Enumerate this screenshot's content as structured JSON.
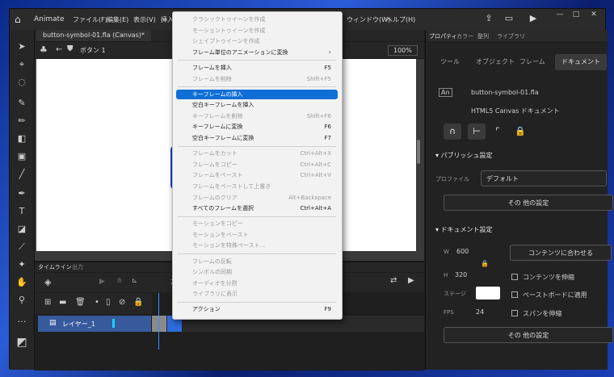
{
  "app": {
    "name": "Animate"
  },
  "menubar": [
    "ファイル(F)",
    "編集(E)",
    "表示(V)",
    "挿入",
    "ウィンドウ(W)",
    "ヘルプ(H)"
  ],
  "document": {
    "tab": "button-symbol-01.fla (Canvas)*",
    "symbol": "ボタン 1",
    "zoom": "100%"
  },
  "timeline": {
    "tabs": [
      "タイムライン",
      "出力"
    ],
    "frame_number": "24",
    "layer_name": "レイヤー_1"
  },
  "panel": {
    "tabs": [
      "プロパティ",
      "カラー",
      "整列",
      "ライブラリ"
    ],
    "subtabs": [
      "ツール",
      "オブジェクト",
      "フレーム",
      "ドキュメント"
    ],
    "active_subtab": "ドキュメント",
    "doc_name": "button-symbol-01.fla",
    "doc_type": "HTML5 Canvas ドキュメント",
    "publish_header": "パブリッシュ設定",
    "profile_label": "プロファイル",
    "profile_value": "デフォルト",
    "other_settings": "その 他の設定",
    "doc_settings_header": "ドキュメント設定",
    "w_label": "W",
    "w_value": "600",
    "h_label": "H",
    "h_value": "320",
    "fit_button": "コンテンツに合わせる",
    "stretch_content": "コンテンツを伸縮",
    "stage_label": "ステージ",
    "pasteboard": "ペーストボードに適用",
    "fps_label": "FPS",
    "fps_value": "24",
    "span_stretch": "スパンを伸縮",
    "other_settings2": "その 他の設定"
  },
  "context_menu": {
    "items": [
      {
        "label": "クラシックトゥイーンを作成",
        "shortcut": "",
        "enabled": false
      },
      {
        "label": "モーショントゥイーンを作成",
        "shortcut": "",
        "enabled": false
      },
      {
        "label": "シェイプトゥイーンを作成",
        "shortcut": "",
        "enabled": false
      },
      {
        "label": "フレーム単位のアニメーションに変換",
        "shortcut": "",
        "enabled": true,
        "submenu": true
      },
      {
        "label": "フレームを挿入",
        "shortcut": "F5",
        "enabled": true
      },
      {
        "label": "フレームを削除",
        "shortcut": "Shift+F5",
        "enabled": false
      },
      {
        "label": "キーフレームの挿入",
        "shortcut": "",
        "enabled": true,
        "highlighted": true
      },
      {
        "label": "空白キーフレームを挿入",
        "shortcut": "",
        "enabled": true
      },
      {
        "label": "キーフレームを削除",
        "shortcut": "Shift+F6",
        "enabled": false
      },
      {
        "label": "キーフレームに変換",
        "shortcut": "F6",
        "enabled": true
      },
      {
        "label": "空白キーフレームに変換",
        "shortcut": "F7",
        "enabled": true
      },
      {
        "label": "フレームをカット",
        "shortcut": "Ctrl+Alt+X",
        "enabled": false
      },
      {
        "label": "フレームをコピー",
        "shortcut": "Ctrl+Alt+C",
        "enabled": false
      },
      {
        "label": "フレームをペースト",
        "shortcut": "Ctrl+Alt+V",
        "enabled": false
      },
      {
        "label": "フレームをペーストして上書き",
        "shortcut": "",
        "enabled": false
      },
      {
        "label": "フレームのクリア",
        "shortcut": "Alt+Backspace",
        "enabled": false
      },
      {
        "label": "すべてのフレームを選択",
        "shortcut": "Ctrl+Alt+A",
        "enabled": true
      },
      {
        "label": "モーションをコピー",
        "shortcut": "",
        "enabled": false
      },
      {
        "label": "モーションをペースト",
        "shortcut": "",
        "enabled": false
      },
      {
        "label": "モーションを特殊ペースト...",
        "shortcut": "",
        "enabled": false
      },
      {
        "label": "フレームの反転",
        "shortcut": "",
        "enabled": false
      },
      {
        "label": "シンボルの同期",
        "shortcut": "",
        "enabled": false
      },
      {
        "label": "オーディオを分割",
        "shortcut": "",
        "enabled": false
      },
      {
        "label": "ライブラリに表示",
        "shortcut": "",
        "enabled": false
      },
      {
        "label": "アクション",
        "shortcut": "F9",
        "enabled": true
      }
    ]
  }
}
